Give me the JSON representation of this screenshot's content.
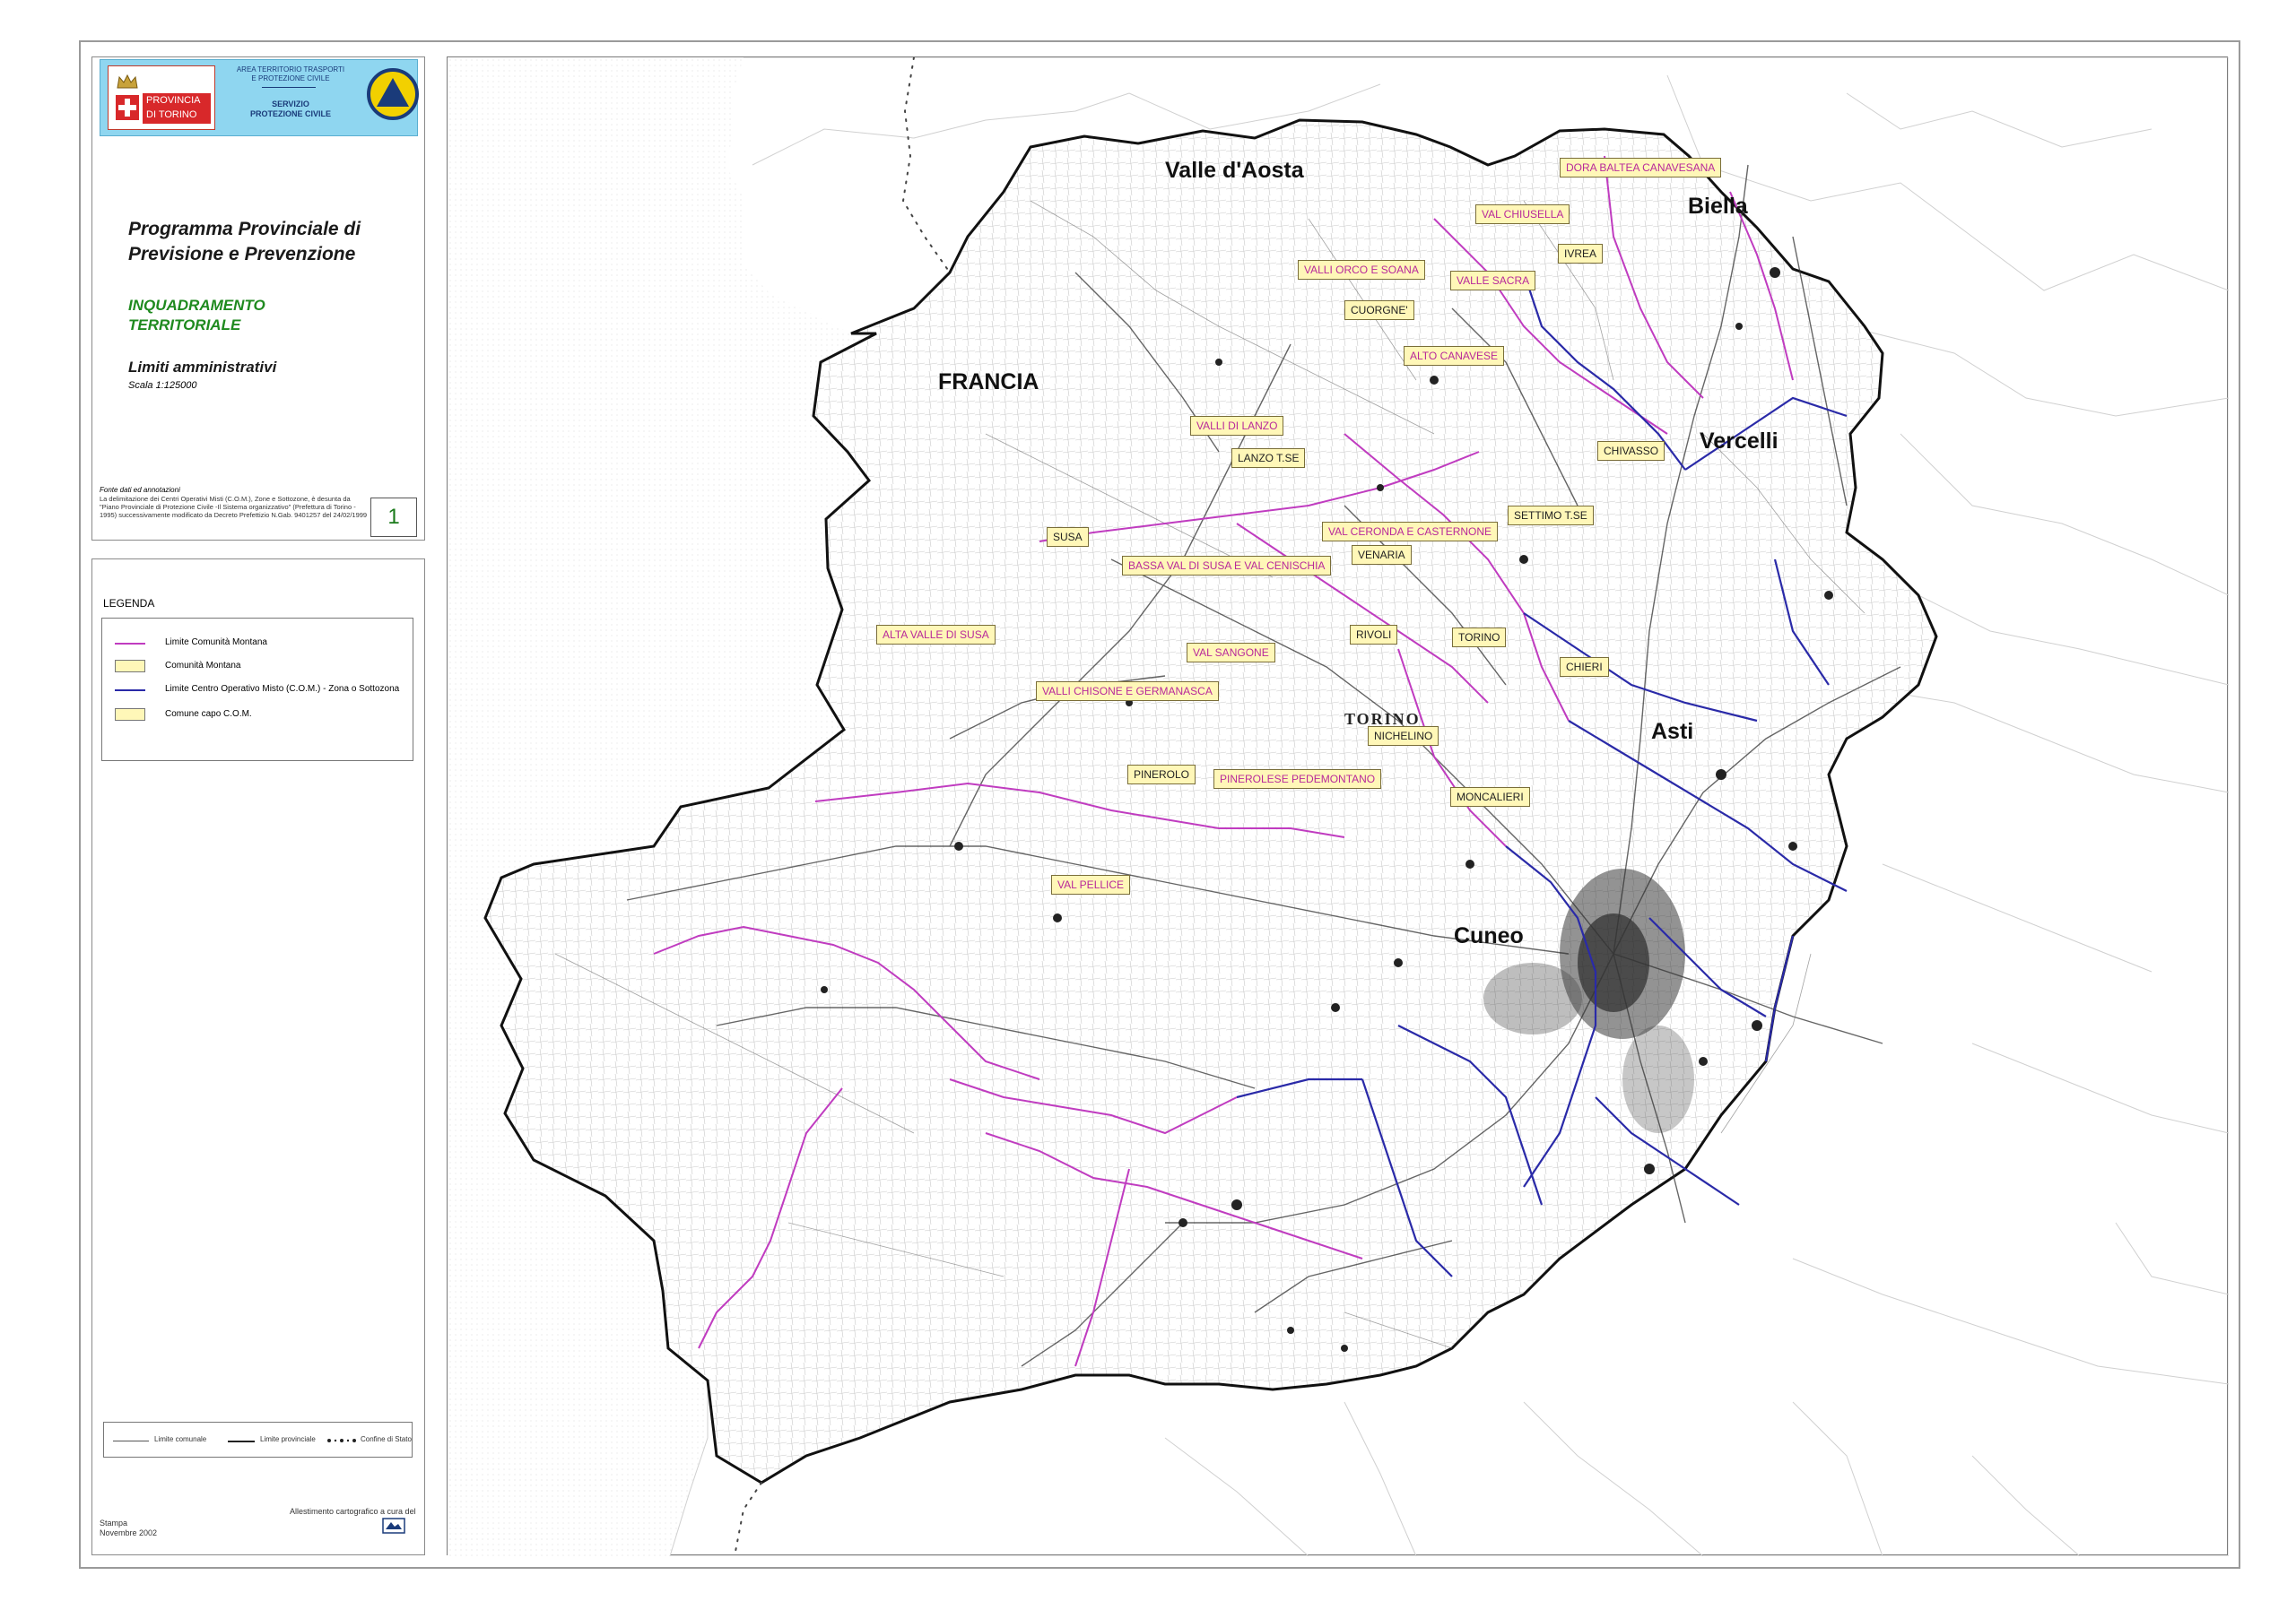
{
  "header": {
    "dept_line1": "AREA TERRITORIO TRASPORTI",
    "dept_line2": "E PROTEZIONE CIVILE",
    "service_line1": "SERVIZIO",
    "service_line2": "PROTEZIONE CIVILE",
    "logo_line1": "PROVINCIA",
    "logo_line2": "DI TORINO"
  },
  "title": {
    "line1": "Programma Provinciale di",
    "line2": "Previsione e Prevenzione",
    "section_line1": "INQUADRAMENTO",
    "section_line2": "TERRITORIALE",
    "subject": "Limiti amministrativi",
    "scale": "Scala 1:125000"
  },
  "sources": {
    "heading": "Fonte dati ed annotazioni",
    "text": "La delimitazione dei Centri Operativi Misti (C.O.M.), Zone e Sottozone, è desunta da \"Piano Provinciale di Protezione Civile -Il Sistema organizzativo\" (Prefettura di Torino - 1995) successivamente modificato da Decreto Prefettizio N.Gab. 9401257 del 24/02/1999"
  },
  "sheet_number": "1",
  "legend": {
    "title": "LEGENDA",
    "items": [
      {
        "label": "Limite Comunità Montana",
        "color": "#c03cc0",
        "kind": "line"
      },
      {
        "label": "Comunità Montana",
        "kind": "swatch",
        "sample": "VALLE SACRA"
      },
      {
        "label": "Limite Centro Operativo Misto (C.O.M.) - Zona o Sottozona",
        "color": "#2a2aa8",
        "kind": "line"
      },
      {
        "label": "Comune capo C.O.M.",
        "kind": "swatch",
        "sample": "TORINO"
      }
    ],
    "footer": {
      "comunale": "Limite comunale",
      "provinciale": "Limite provinciale",
      "stato": "Confine di Stato"
    },
    "credit": "Allestimento cartografico a cura del",
    "print_line1": "Stampa",
    "print_line2": "Novembre 2002"
  },
  "map": {
    "neighbors": {
      "valle_daosta": "Valle d'Aosta",
      "francia": "FRANCIA",
      "biella": "Biella",
      "vercelli": "Vercelli",
      "asti": "Asti",
      "cuneo": "Cuneo"
    },
    "comunita_montane": {
      "dora_baltea": "DORA BALTEA CANAVESANA",
      "val_chiusella": "VAL CHIUSELLA",
      "valli_orco": "VALLI ORCO E SOANA",
      "valle_sacra": "VALLE SACRA",
      "alto_canavese": "ALTO CANAVESE",
      "valli_lanzo": "VALLI DI LANZO",
      "val_ceronda": "VAL CERONDA E CASTERNONE",
      "bassa_val_susa": "BASSA VAL DI SUSA E VAL CENISCHIA",
      "alta_valle_susa": "ALTA VALLE DI SUSA",
      "val_sangone": "VAL SANGONE",
      "valli_chisone": "VALLI CHISONE E GERMANASCA",
      "pinerolese": "PINEROLESE PEDEMONTANO",
      "val_pellice": "VAL PELLICE"
    },
    "com_capi": {
      "ivrea": "IVREA",
      "cuorgne": "CUORGNE'",
      "lanzo": "LANZO T.SE",
      "chivasso": "CHIVASSO",
      "settimo": "SETTIMO T.SE",
      "venaria": "VENARIA",
      "susa": "SUSA",
      "rivoli": "RIVOLI",
      "torino": "TORINO",
      "chieri": "CHIERI",
      "nichelino": "NICHELINO",
      "pinerolo": "PINEROLO",
      "moncalieri": "MONCALIERI"
    },
    "city_text": "TORINO",
    "colors": {
      "montana_boundary": "#c03cc0",
      "com_boundary": "#2a2aa8",
      "label_fill": "#fff7b8"
    }
  }
}
